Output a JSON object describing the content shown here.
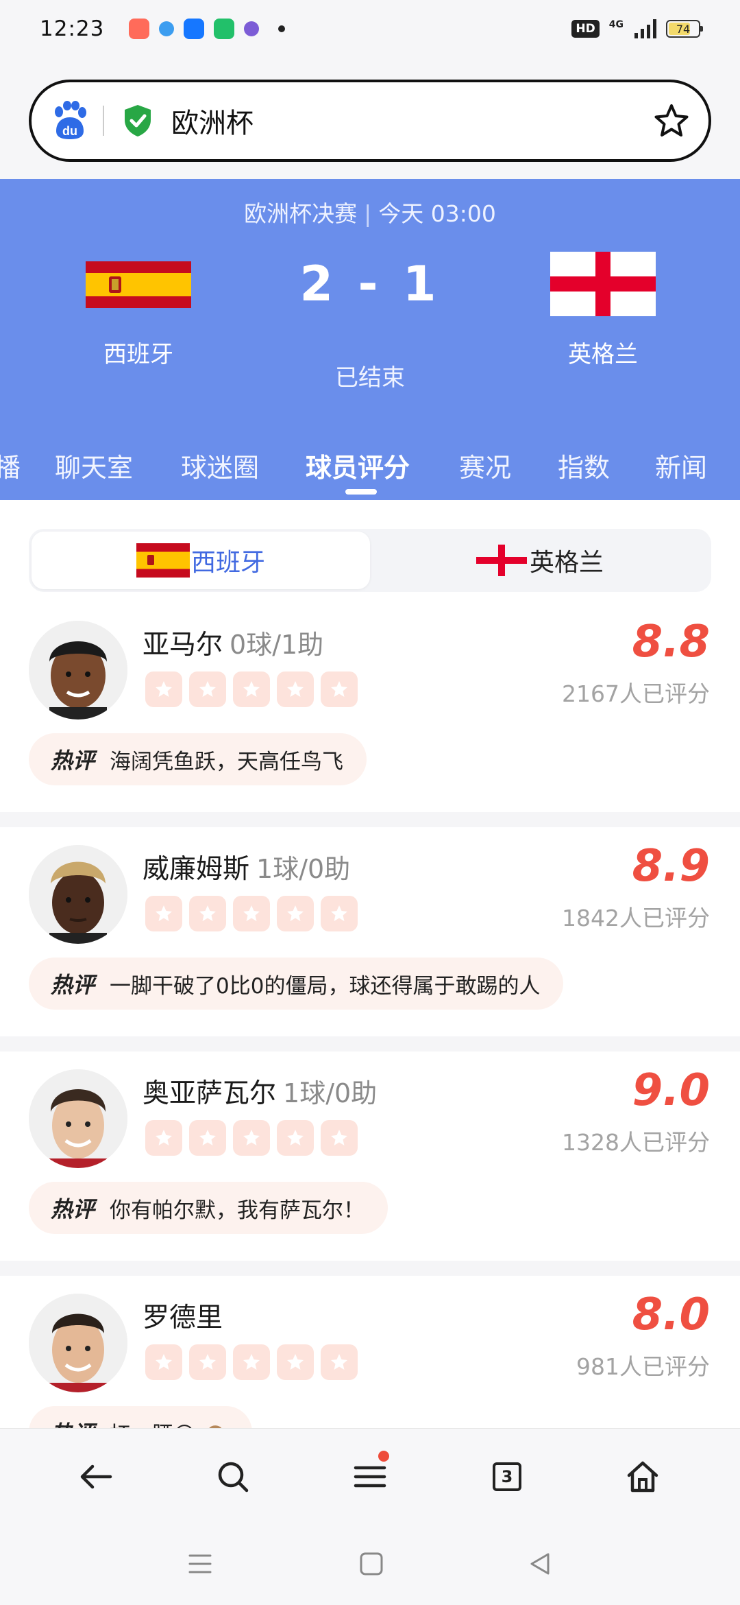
{
  "status_bar": {
    "time": "12:23",
    "hd": "HD",
    "network": "4G",
    "battery": "74",
    "battery_level": 0.74
  },
  "search": {
    "query": "欧洲杯"
  },
  "match": {
    "title": "欧洲杯决赛",
    "time": "今天 03:00",
    "home_team": "西班牙",
    "away_team": "英格兰",
    "score": "2 - 1",
    "status": "已结束"
  },
  "tabs": [
    {
      "label": "播"
    },
    {
      "label": "聊天室"
    },
    {
      "label": "球迷圈"
    },
    {
      "label": "球员评分"
    },
    {
      "label": "赛况"
    },
    {
      "label": "指数"
    },
    {
      "label": "新闻"
    }
  ],
  "team_toggle": {
    "home": "西班牙",
    "away": "英格兰"
  },
  "hot_label": "热评",
  "players": [
    {
      "name": "亚马尔",
      "stat": "0球/1助",
      "rating": "8.8",
      "raters": "2167人已评分",
      "comment": "海阔凭鱼跃，天高任鸟飞"
    },
    {
      "name": "威廉姆斯",
      "stat": "1球/0助",
      "rating": "8.9",
      "raters": "1842人已评分",
      "comment": "一脚干破了0比0的僵局，球还得属于敢踢的人"
    },
    {
      "name": "奥亚萨瓦尔",
      "stat": "1球/0助",
      "rating": "9.0",
      "raters": "1328人已评分",
      "comment": "你有帕尔默，我有萨瓦尔！"
    },
    {
      "name": "罗德里",
      "stat": "",
      "rating": "8.0",
      "raters": "981人已评分",
      "comment": "扛一腰😋 🙈"
    }
  ],
  "bottom_nav": {
    "tab_count": "3"
  },
  "colors": {
    "header_blue": "#6a8eeb",
    "rating_red": "#ef4f41",
    "active_toggle": "#4169e1",
    "star_bg": "#fde3dc"
  }
}
